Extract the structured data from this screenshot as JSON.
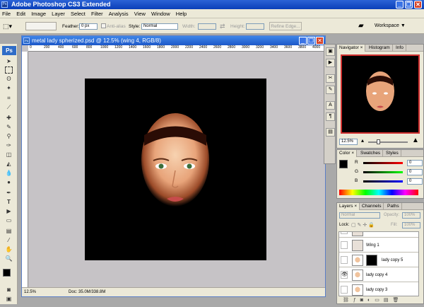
{
  "app": {
    "title": "Adobe Photoshop CS3 Extended",
    "logo": "Ps",
    "workspace_label": "Workspace ▼"
  },
  "window_controls": {
    "minimize": "_",
    "restore": "❐",
    "close": "✕"
  },
  "menu": [
    "File",
    "Edit",
    "Image",
    "Layer",
    "Select",
    "Filter",
    "Analysis",
    "View",
    "Window",
    "Help"
  ],
  "options": {
    "feather_label": "Feather:",
    "feather_value": "0 px",
    "antialias_label": "Anti-alias",
    "style_label": "Style:",
    "style_value": "Normal",
    "width_label": "Width:",
    "height_label": "Height:",
    "refine_edge": "Refine Edge..."
  },
  "document": {
    "title": "metal lady spherized.psd @ 12.5% (wing 4, RGB/8)",
    "zoom": "12.5%",
    "doc_size": "Doc: 35.0M/338.8M",
    "ruler_ticks": [
      "0",
      "200",
      "400",
      "600",
      "800",
      "1000",
      "1200",
      "1400",
      "1600",
      "1800",
      "2000",
      "2200",
      "2400",
      "2600",
      "2800",
      "3000",
      "3200",
      "3400",
      "3600",
      "3800",
      "4000"
    ]
  },
  "navigator": {
    "tabs": [
      "Navigator ×",
      "Histogram",
      "Info"
    ],
    "zoom": "12.5%"
  },
  "color": {
    "tabs": [
      "Color ×",
      "Swatches",
      "Styles"
    ],
    "channels": [
      {
        "label": "R",
        "value": "0",
        "color": "#cc0000"
      },
      {
        "label": "G",
        "value": "0",
        "color": "#00a000"
      },
      {
        "label": "B",
        "value": "0",
        "color": "#0000cc"
      }
    ],
    "foreground": "#000000",
    "background": "#ffffff"
  },
  "layers": {
    "tabs": [
      "Layers ×",
      "Channels",
      "Paths"
    ],
    "blend_mode": "Normal",
    "opacity_label": "Opacity:",
    "opacity_value": "100%",
    "lock_label": "Lock:",
    "fill_label": "Fill:",
    "fill_value": "100%",
    "items": [
      {
        "name": ""
      },
      {
        "name": "Wing 1"
      },
      {
        "name": "lady copy 5"
      },
      {
        "name": "lady copy 4"
      },
      {
        "name": "lady copy 3"
      }
    ]
  }
}
